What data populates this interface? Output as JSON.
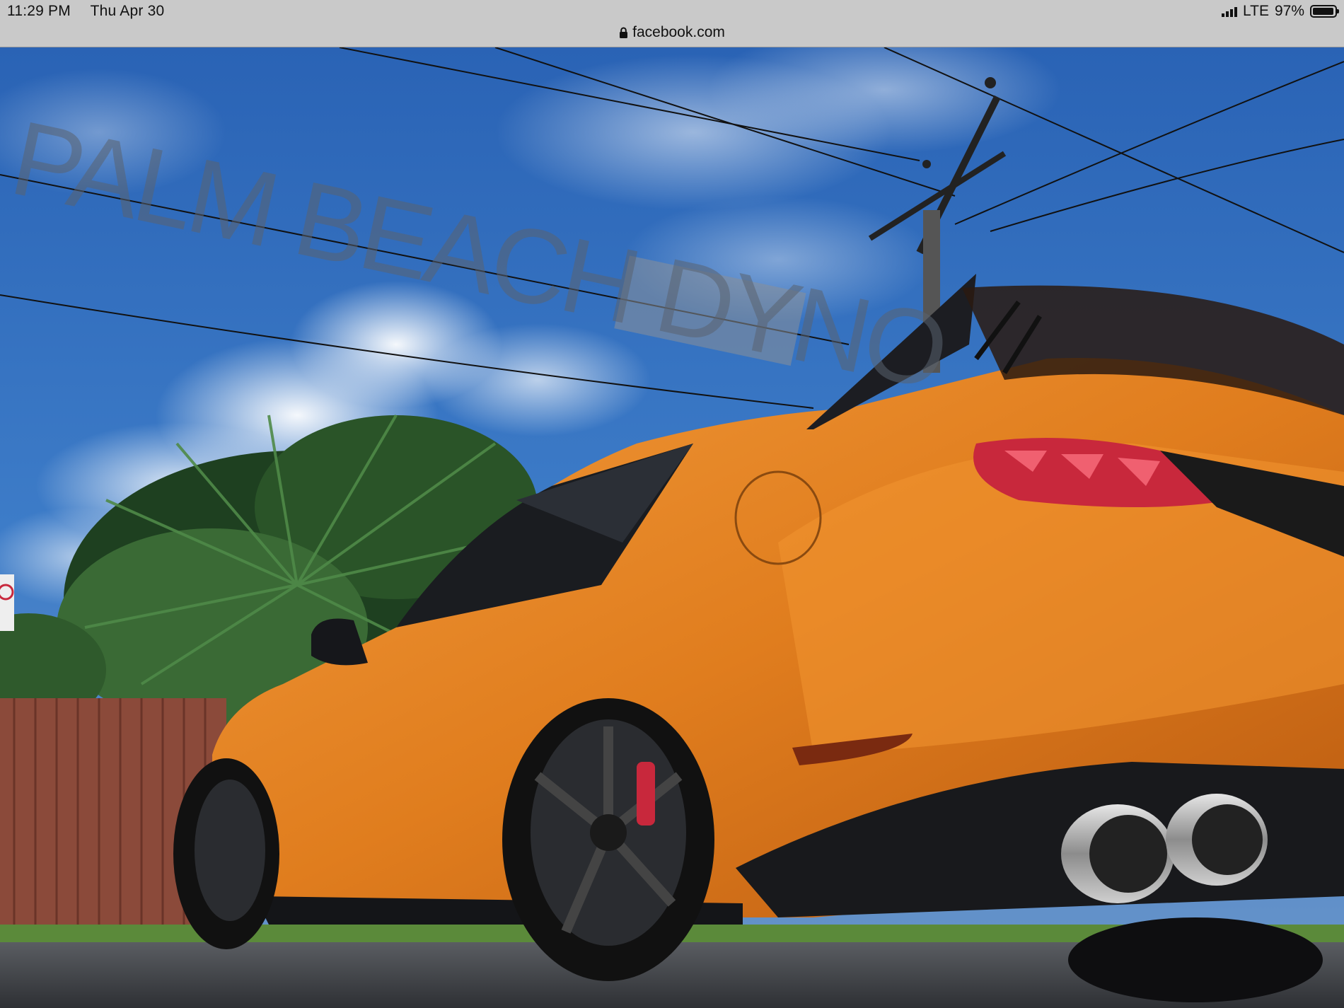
{
  "status_bar": {
    "time": "11:29 PM",
    "date": "Thu Apr 30",
    "network": "LTE",
    "battery_percent": "97%",
    "battery_level": 0.97
  },
  "address_bar": {
    "url": "facebook.com",
    "icon": "lock-icon"
  },
  "photo": {
    "watermark_text": "PALM BEACH DYNO",
    "colors": {
      "sky": "#2f6fc0",
      "car": "#e8801f",
      "taillight": "#c8283c"
    }
  }
}
